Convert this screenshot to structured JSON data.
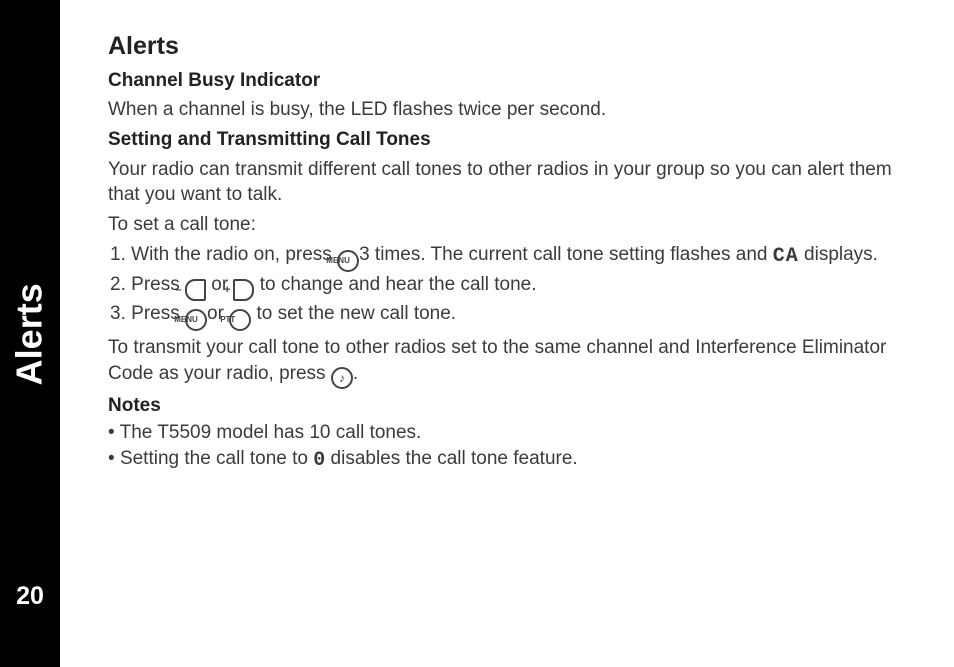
{
  "sidebar": {
    "label": "Alerts",
    "page_number": "20"
  },
  "title": "Alerts",
  "sections": {
    "busy": {
      "heading": "Channel Busy Indicator",
      "body": "When a channel is busy, the LED flashes twice per second."
    },
    "tones": {
      "heading": "Setting and Transmitting Call Tones",
      "intro": "Your radio can transmit different call tones to other radios in your group so you can alert them that you want to talk.",
      "lead": "To set a call tone:",
      "step1_a": "With the radio on, press ",
      "step1_b": "3 times. The current call tone setting flashes and ",
      "step1_c": " displays.",
      "step2_a": "Press ",
      "step2_b": " or ",
      "step2_c": " to change and hear the call tone.",
      "step3_a": "Press ",
      "step3_b": "or ",
      "step3_c": " to set the new call tone.",
      "transmit_a": "To transmit your call tone to other radios set to the same channel and Interference Eliminator Code as your radio, press ",
      "transmit_b": "."
    },
    "notes": {
      "heading": "Notes",
      "n1": "The T5509 model has 10 call tones.",
      "n2_a": "Setting the call tone to ",
      "n2_b": " disables the call tone feature."
    }
  },
  "icons": {
    "menu": "MENU",
    "left": "–",
    "right": "+",
    "ptt": "PTT",
    "call": "♪",
    "ca": "CA",
    "zero": "0"
  }
}
